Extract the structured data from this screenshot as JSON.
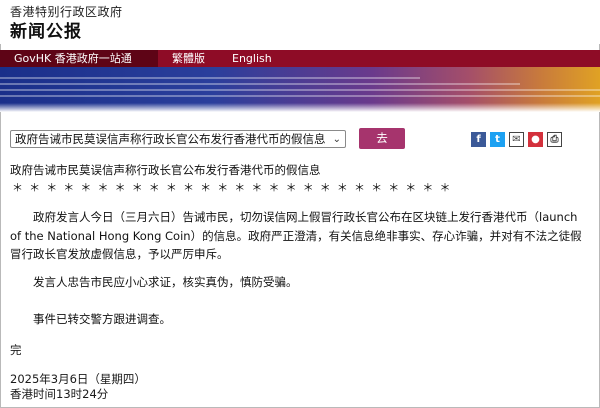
{
  "header": {
    "site_name": "香港特别行政区政府",
    "section_title": "新闻公报"
  },
  "nav": {
    "govhk": "GovHK 香港政府一站通",
    "traditional": "繁體版",
    "english": "English"
  },
  "toolbar": {
    "selected_article": "政府告诫市民莫误信声称行政长官公布发行香港代币的假信息",
    "go_label": "去",
    "share_icons": [
      "facebook-icon",
      "twitter-icon",
      "email-icon",
      "weibo-icon",
      "print-icon"
    ]
  },
  "article": {
    "title": "政府告诫市民莫误信声称行政长官公布发行香港代币的假信息",
    "separator": "＊＊＊＊＊＊＊＊＊＊＊＊＊＊＊＊＊＊＊＊＊＊＊＊＊＊",
    "paragraphs": [
      "政府发言人今日（三月六日）告诫市民，切勿误信网上假冒行政长官公布在区块链上发行香港代币（launch of the National Hong Kong Coin）的信息。政府严正澄清，有关信息绝非事实、存心诈骗，并对有不法之徒假冒行政长官发放虚假信息，予以严厉申斥。",
      "发言人忠告市民应小心求证，核实真伪，慎防受骗。",
      "事件已转交警方跟进调查。"
    ],
    "end_mark": "完",
    "date": "2025年3月6日（星期四）",
    "time": "香港时间13时24分"
  },
  "colors": {
    "nav_bar": "#8e0c26",
    "nav_govhk": "#5e0416",
    "go_button": "#a6346d"
  }
}
